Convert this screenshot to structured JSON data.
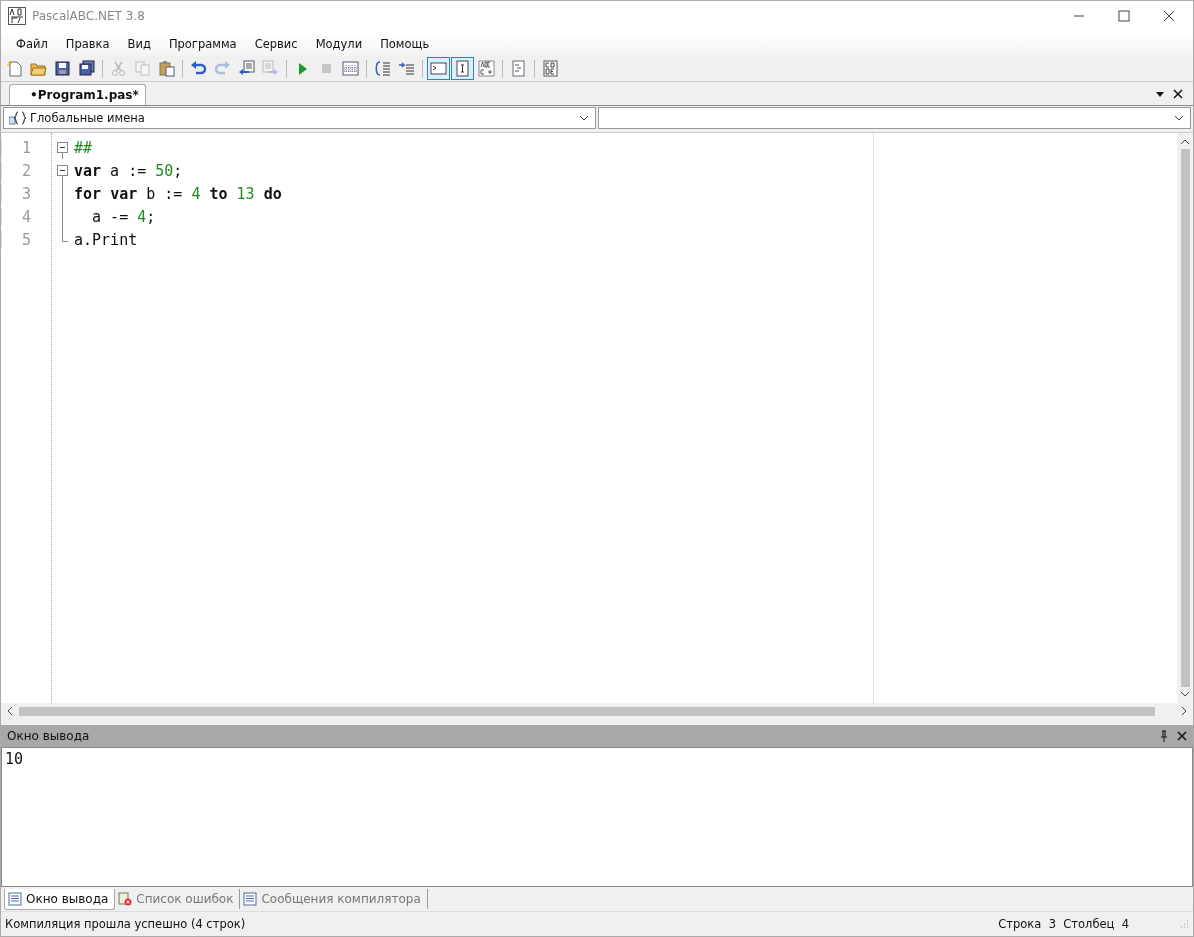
{
  "window": {
    "title": "PascalABC.NET 3.8"
  },
  "menu": [
    "Файл",
    "Правка",
    "Вид",
    "Программа",
    "Сервис",
    "Модули",
    "Помощь"
  ],
  "toolbar": [
    {
      "kind": "button",
      "disabled": false,
      "pressed": false
    },
    {
      "kind": "button",
      "disabled": false,
      "pressed": false
    },
    {
      "kind": "button",
      "disabled": false,
      "pressed": false
    },
    {
      "kind": "button",
      "disabled": false,
      "pressed": false
    },
    {
      "kind": "separator"
    },
    {
      "kind": "button",
      "disabled": true,
      "pressed": false
    },
    {
      "kind": "button",
      "disabled": true,
      "pressed": false
    },
    {
      "kind": "button",
      "disabled": false,
      "pressed": false
    },
    {
      "kind": "separator"
    },
    {
      "kind": "button",
      "disabled": false,
      "pressed": false
    },
    {
      "kind": "button",
      "disabled": true,
      "pressed": false
    },
    {
      "kind": "button",
      "disabled": false,
      "pressed": false
    },
    {
      "kind": "button",
      "disabled": true,
      "pressed": false
    },
    {
      "kind": "separator"
    },
    {
      "kind": "button",
      "disabled": false,
      "pressed": false
    },
    {
      "kind": "button",
      "disabled": true,
      "pressed": false
    },
    {
      "kind": "button",
      "disabled": false,
      "pressed": false
    },
    {
      "kind": "separator"
    },
    {
      "kind": "button",
      "disabled": false,
      "pressed": false
    },
    {
      "kind": "button",
      "disabled": false,
      "pressed": false
    },
    {
      "kind": "separator"
    },
    {
      "kind": "button",
      "disabled": false,
      "pressed": true
    },
    {
      "kind": "button",
      "disabled": false,
      "pressed": true
    },
    {
      "kind": "button",
      "disabled": false,
      "pressed": false
    },
    {
      "kind": "separator"
    },
    {
      "kind": "button",
      "disabled": false,
      "pressed": false
    },
    {
      "kind": "separator"
    },
    {
      "kind": "button",
      "disabled": false,
      "pressed": false
    }
  ],
  "editor_tabs": [
    {
      "label": "•Program1.pas*",
      "selected": true
    }
  ],
  "scope_selector": {
    "value": "Глобальные имена"
  },
  "code_lines": [
    {
      "number": "1",
      "kind": "start",
      "tokens": [
        {
          "text": "##",
          "kind": "directive"
        }
      ]
    },
    {
      "number": "2",
      "kind": "start",
      "tokens": [
        {
          "text": "var",
          "kind": "keyword"
        },
        {
          "text": " a := ",
          "kind": "plain"
        },
        {
          "text": "50",
          "kind": "number"
        },
        {
          "text": ";",
          "kind": "plain"
        }
      ]
    },
    {
      "number": "3",
      "kind": "inner",
      "tokens": [
        {
          "text": "for ",
          "kind": "keyword"
        },
        {
          "text": "var",
          "kind": "keyword"
        },
        {
          "text": " b := ",
          "kind": "plain"
        },
        {
          "text": "4 ",
          "kind": "number"
        },
        {
          "text": "to ",
          "kind": "keyword"
        },
        {
          "text": "13 ",
          "kind": "number"
        },
        {
          "text": "do",
          "kind": "keyword"
        }
      ]
    },
    {
      "number": "4",
      "kind": "inner",
      "tokens": [
        {
          "text": "  a -= ",
          "kind": "plain"
        },
        {
          "text": "4",
          "kind": "number"
        },
        {
          "text": ";",
          "kind": "plain"
        }
      ]
    },
    {
      "number": "5",
      "kind": "end",
      "tokens": [
        {
          "text": "a.Print",
          "kind": "plain"
        }
      ]
    }
  ],
  "output_panel": {
    "title": "Окно вывода",
    "text": "10"
  },
  "bottom_tabs": [
    {
      "label": "Окно вывода",
      "selected": true
    },
    {
      "label": "Список ошибок",
      "selected": false
    },
    {
      "label": "Сообщения компилятора",
      "selected": false
    }
  ],
  "status_bar": {
    "message": "Компиляция прошла успешно (4 строк)",
    "position": "Строка  3  Столбец  4"
  }
}
